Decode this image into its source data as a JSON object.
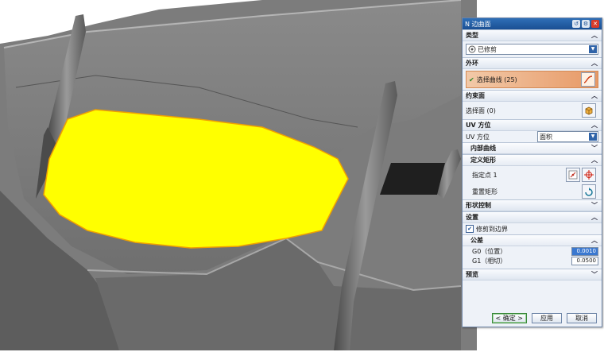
{
  "dialog": {
    "title": "N 边曲面",
    "sections": {
      "type": {
        "label": "类型",
        "value": "已修剪"
      },
      "outer_loop": {
        "label": "外环",
        "select_curve": "选择曲线 (25)"
      },
      "constraint_face": {
        "label": "约束面",
        "select_face": "选择面 (0)"
      },
      "uv_orientation": {
        "label": "UV 方位",
        "orientation_label": "UV 方位",
        "orientation_value": "面积",
        "inner_curves": "内部曲线",
        "define_rect": "定义矩形",
        "specify_point": "指定点 1",
        "reset_rect": "重置矩形"
      },
      "shape_control": {
        "label": "形状控制"
      },
      "settings": {
        "label": "设置",
        "trim_to_boundary": "修剪到边界",
        "trim_checked": true,
        "tolerance": {
          "label": "公差",
          "g0_label": "G0（位置）",
          "g0_value": "0.0010",
          "g1_label": "G1（相切）",
          "g1_value": "0.0500"
        }
      },
      "preview": {
        "label": "预览"
      }
    },
    "buttons": {
      "ok": "< 确定 >",
      "apply": "应用",
      "cancel": "取消"
    }
  },
  "colors": {
    "surface_highlight": "#ffff00",
    "curve_selection": "#f0a000",
    "dialog_title": "#1a4f93"
  },
  "icons": {
    "type_icon": "trimmed-surface-icon",
    "curve_icon": "curve-select-icon",
    "face_icon": "cube-face-icon",
    "point_icon": "point-constructor-icon",
    "target_icon": "crosshair-icon",
    "reset_icon": "reset-rectangle-icon"
  }
}
